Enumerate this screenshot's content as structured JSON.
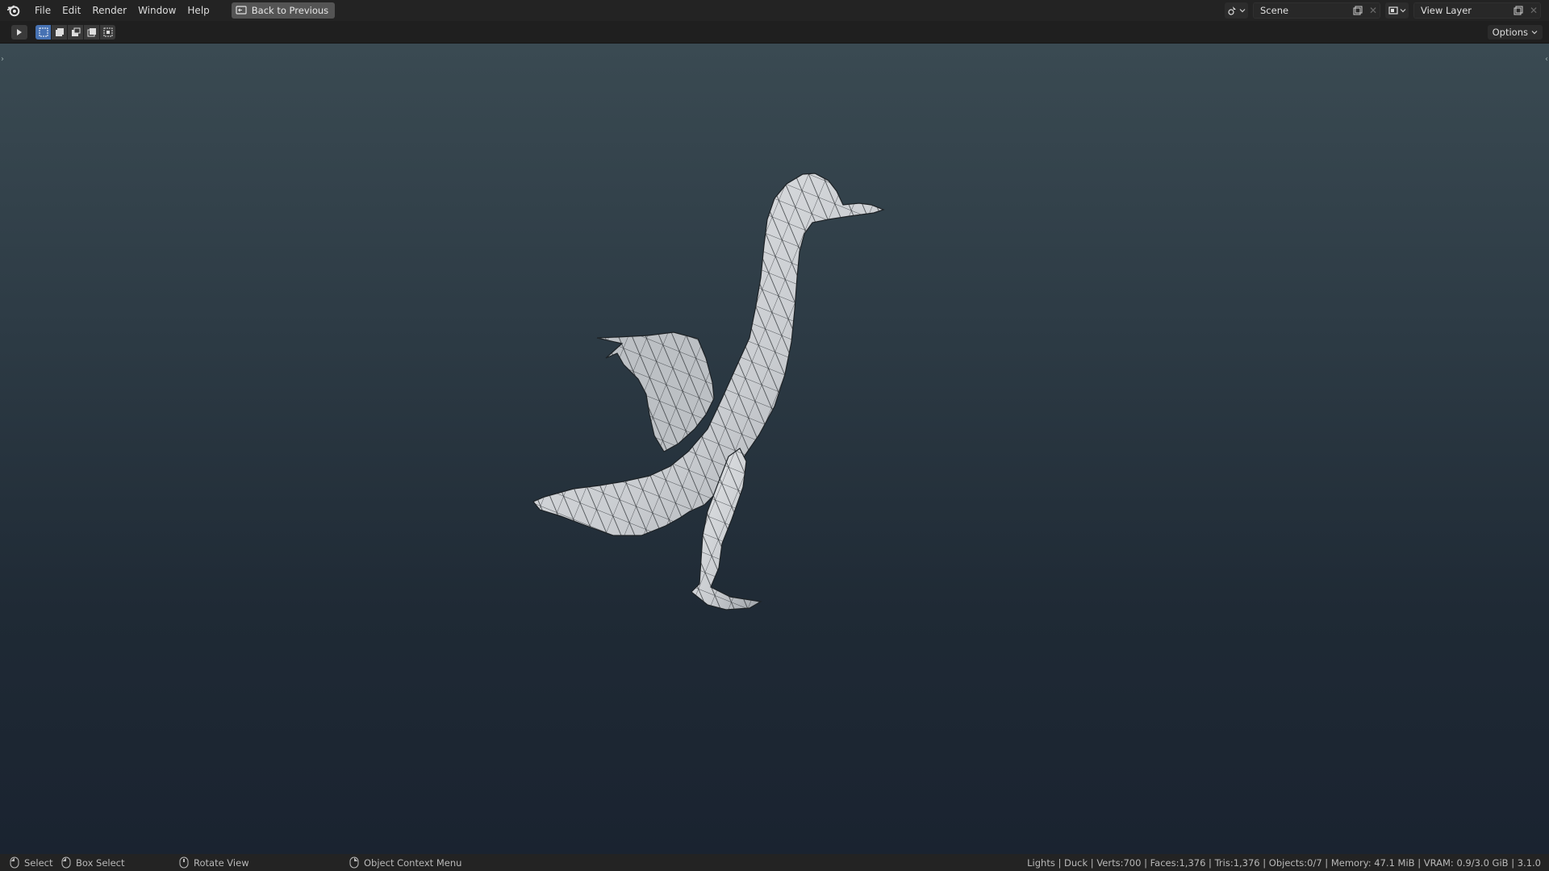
{
  "menu": {
    "items": [
      "File",
      "Edit",
      "Render",
      "Window",
      "Help"
    ],
    "back_button": "Back to Previous"
  },
  "topright": {
    "scene_field": "Scene",
    "view_layer_field": "View Layer"
  },
  "header": {
    "options_label": "Options"
  },
  "statusbar": {
    "select": "Select",
    "box_select": "Box Select",
    "rotate_view": "Rotate View",
    "context_menu": "Object Context Menu",
    "stats": "Lights | Duck | Verts:700 | Faces:1,376 | Tris:1,376 | Objects:0/7 | Memory: 47.1 MiB | VRAM: 0.9/3.0 GiB | 3.1.0"
  },
  "colors": {
    "accent": "#4772b3",
    "viewport_top": "#3a4a52",
    "viewport_bottom": "#1a2330"
  }
}
